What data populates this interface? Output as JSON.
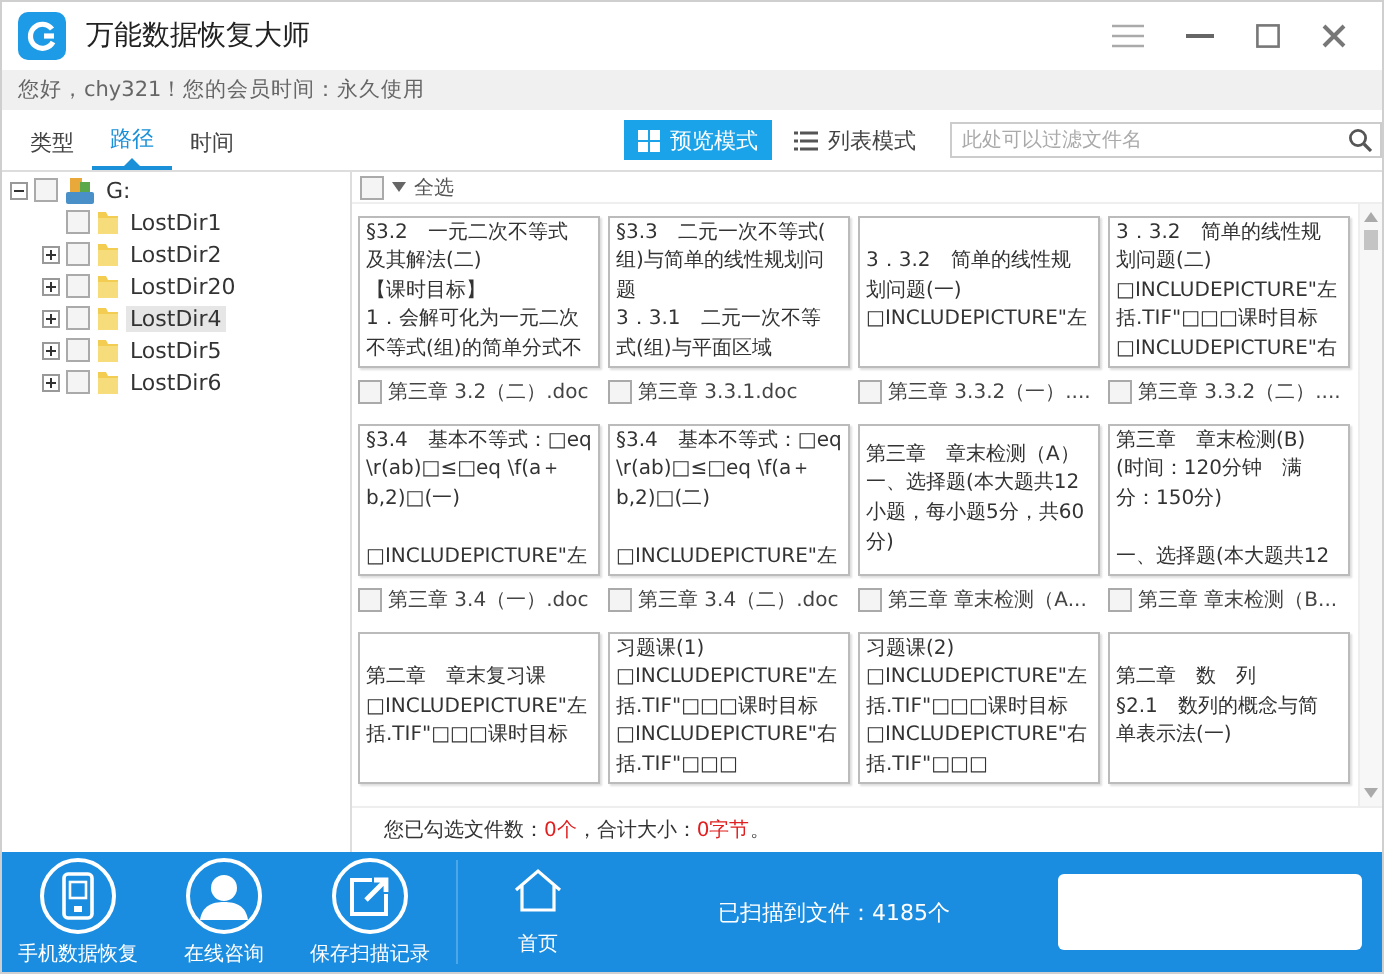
{
  "window": {
    "title": "万能数据恢复大师"
  },
  "greeting": "您好，chy321！您的会员时间：永久使用",
  "tabs": [
    {
      "label": "类型",
      "selected": false
    },
    {
      "label": "路径",
      "selected": true
    },
    {
      "label": "时间",
      "selected": false
    }
  ],
  "view_modes": [
    {
      "label": "预览模式",
      "kind": "grid",
      "selected": true
    },
    {
      "label": "列表模式",
      "kind": "list",
      "selected": false
    }
  ],
  "search": {
    "placeholder": "此处可以过滤文件名"
  },
  "tree": {
    "label": "G:",
    "checked": false,
    "expanded": true,
    "children": [
      {
        "label": "LostDir1",
        "kind": "leaf",
        "checked": false,
        "selected": false
      },
      {
        "label": "LostDir2",
        "kind": "branch",
        "checked": false,
        "selected": false
      },
      {
        "label": "LostDir20",
        "kind": "branch",
        "checked": false,
        "selected": false
      },
      {
        "label": "LostDir4",
        "kind": "branch",
        "checked": false,
        "selected": true
      },
      {
        "label": "LostDir5",
        "kind": "branch",
        "checked": false,
        "selected": false
      },
      {
        "label": "LostDir6",
        "kind": "branch",
        "checked": false,
        "selected": false
      }
    ]
  },
  "select_all": {
    "label": "全选",
    "checked": false
  },
  "files": [
    {
      "paragraphs": [
        [
          "§3.2　一元二次不等式",
          "及其解法(二)",
          "【课时目标】",
          "1．会解可化为一元二次",
          "不等式(组)的简单分式不"
        ]
      ],
      "name": "第三章 3.2（二）.doc",
      "checked": false
    },
    {
      "paragraphs": [
        [
          "§3.3　二元一次不等式(",
          "组)与简单的线性规划问",
          "题",
          "3．3.1　二元一次不等",
          "式(组)与平面区域"
        ]
      ],
      "name": "第三章 3.3.1.doc",
      "checked": false
    },
    {
      "paragraphs": [
        [
          "3．3.2　简单的线性规",
          "划问题(一)",
          "□INCLUDEPICTURE\"左"
        ]
      ],
      "name": "第三章 3.3.2（一）....",
      "checked": false
    },
    {
      "paragraphs": [
        [
          "3．3.2　简单的线性规",
          "划问题(二)",
          "□INCLUDEPICTURE\"左",
          "括.TIF\"□□□课时目标",
          "□INCLUDEPICTURE\"右"
        ]
      ],
      "name": "第三章 3.3.2（二）....",
      "checked": false
    },
    {
      "paragraphs": [
        [
          "§3.4　基本不等式：□eq",
          "\\r(ab)□≤□eq \\f(a＋",
          "b,2)□(一)"
        ],
        [
          "□INCLUDEPICTURE\"左"
        ]
      ],
      "name": "第三章 3.4（一）.doc",
      "checked": false
    },
    {
      "paragraphs": [
        [
          "§3.4　基本不等式：□eq",
          "\\r(ab)□≤□eq \\f(a＋",
          "b,2)□(二)"
        ],
        [
          "□INCLUDEPICTURE\"左"
        ]
      ],
      "name": "第三章 3.4（二）.doc",
      "checked": false
    },
    {
      "paragraphs": [
        [
          "第三章　章末检测（A）",
          "一、选择题(本大题共12",
          "小题，每小题5分，共60",
          "分)"
        ]
      ],
      "name": "第三章 章末检测（A...",
      "checked": false
    },
    {
      "paragraphs": [
        [
          "第三章　章末检测(B)",
          "(时间：120分钟　满",
          "分：150分)"
        ],
        [
          "一、选择题(本大题共12"
        ]
      ],
      "name": "第三章 章末检测（B...",
      "checked": false
    },
    {
      "paragraphs": [
        [
          "第二章　章末复习课",
          "□INCLUDEPICTURE\"左",
          "括.TIF\"□□□课时目标"
        ]
      ]
    },
    {
      "paragraphs": [
        [
          "习题课(1)",
          "□INCLUDEPICTURE\"左",
          "括.TIF\"□□□课时目标",
          "□INCLUDEPICTURE\"右",
          "括.TIF\"□□□"
        ]
      ]
    },
    {
      "paragraphs": [
        [
          "习题课(2)",
          "□INCLUDEPICTURE\"左",
          "括.TIF\"□□□课时目标",
          "□INCLUDEPICTURE\"右",
          "括.TIF\"□□□"
        ]
      ]
    },
    {
      "paragraphs": [
        [
          "第二章　数　列",
          "§2.1　数列的概念与简",
          "单表示法(一)"
        ]
      ]
    }
  ],
  "selection_status": [
    {
      "text": "您已勾选文件数：",
      "kind": "plain"
    },
    {
      "text": "0个",
      "kind": "value"
    },
    {
      "text": "，合计大小：",
      "kind": "plain"
    },
    {
      "text": "0字节",
      "kind": "value"
    },
    {
      "text": "。",
      "kind": "plain"
    }
  ],
  "bottom_actions": [
    {
      "label": "手机数据恢复",
      "kind": "phone"
    },
    {
      "label": "在线咨询",
      "kind": "person"
    },
    {
      "label": "保存扫描记录",
      "kind": "export"
    }
  ],
  "home": {
    "label": "首页"
  },
  "scan_status": "已扫描到文件：4185个"
}
